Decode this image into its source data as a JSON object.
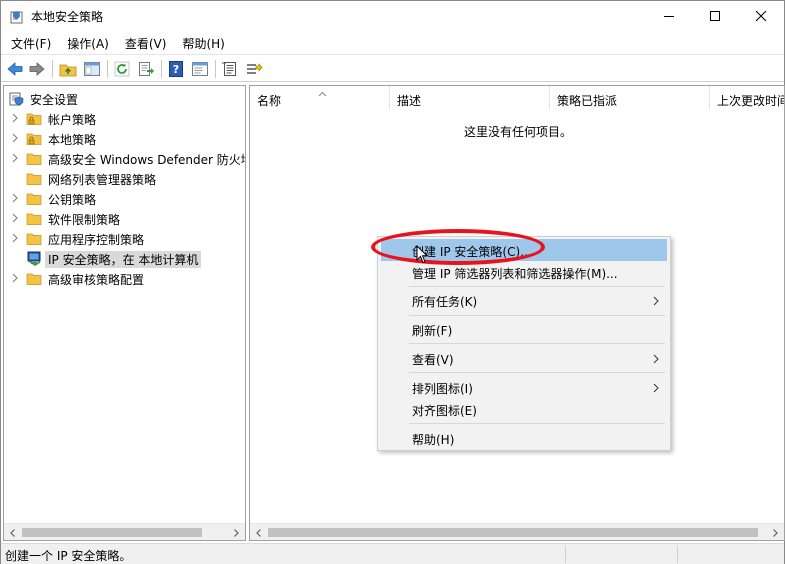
{
  "window": {
    "title": "本地安全策略"
  },
  "menubar": {
    "items": [
      "文件(F)",
      "操作(A)",
      "查看(V)",
      "帮助(H)"
    ]
  },
  "tree": {
    "items": [
      {
        "label": "安全设置",
        "icon": "shield-folder-icon",
        "expanded": true
      },
      {
        "label": "帐户策略",
        "icon": "folder-lock-icon"
      },
      {
        "label": "本地策略",
        "icon": "folder-lock-icon"
      },
      {
        "label": "高级安全 Windows Defender 防火墙",
        "icon": "folder-icon"
      },
      {
        "label": "网络列表管理器策略",
        "icon": "folder-icon"
      },
      {
        "label": "公钥策略",
        "icon": "folder-icon"
      },
      {
        "label": "软件限制策略",
        "icon": "folder-icon"
      },
      {
        "label": "应用程序控制策略",
        "icon": "folder-icon"
      },
      {
        "label": "IP 安全策略，在 本地计算机",
        "icon": "ip-security-icon",
        "selected": true
      },
      {
        "label": "高级审核策略配置",
        "icon": "folder-icon"
      }
    ]
  },
  "list": {
    "columns": [
      "名称",
      "描述",
      "策略已指派",
      "上次更改时间"
    ],
    "empty_message": "这里没有任何项目。"
  },
  "context_menu": {
    "items": [
      {
        "label": "创建 IP 安全策略(C)...",
        "highlighted": true
      },
      {
        "label": "管理 IP 筛选器列表和筛选器操作(M)..."
      },
      {
        "label": "所有任务(K)",
        "submenu": true
      },
      {
        "label": "刷新(F)"
      },
      {
        "label": "查看(V)",
        "submenu": true
      },
      {
        "label": "排列图标(I)",
        "submenu": true
      },
      {
        "label": "对齐图标(E)"
      },
      {
        "label": "帮助(H)"
      }
    ]
  },
  "status": {
    "text": "创建一个 IP 安全策略。"
  },
  "colors": {
    "highlight": "#9fc7ec",
    "annotation": "#e8141c",
    "folder": "#f5c342"
  }
}
